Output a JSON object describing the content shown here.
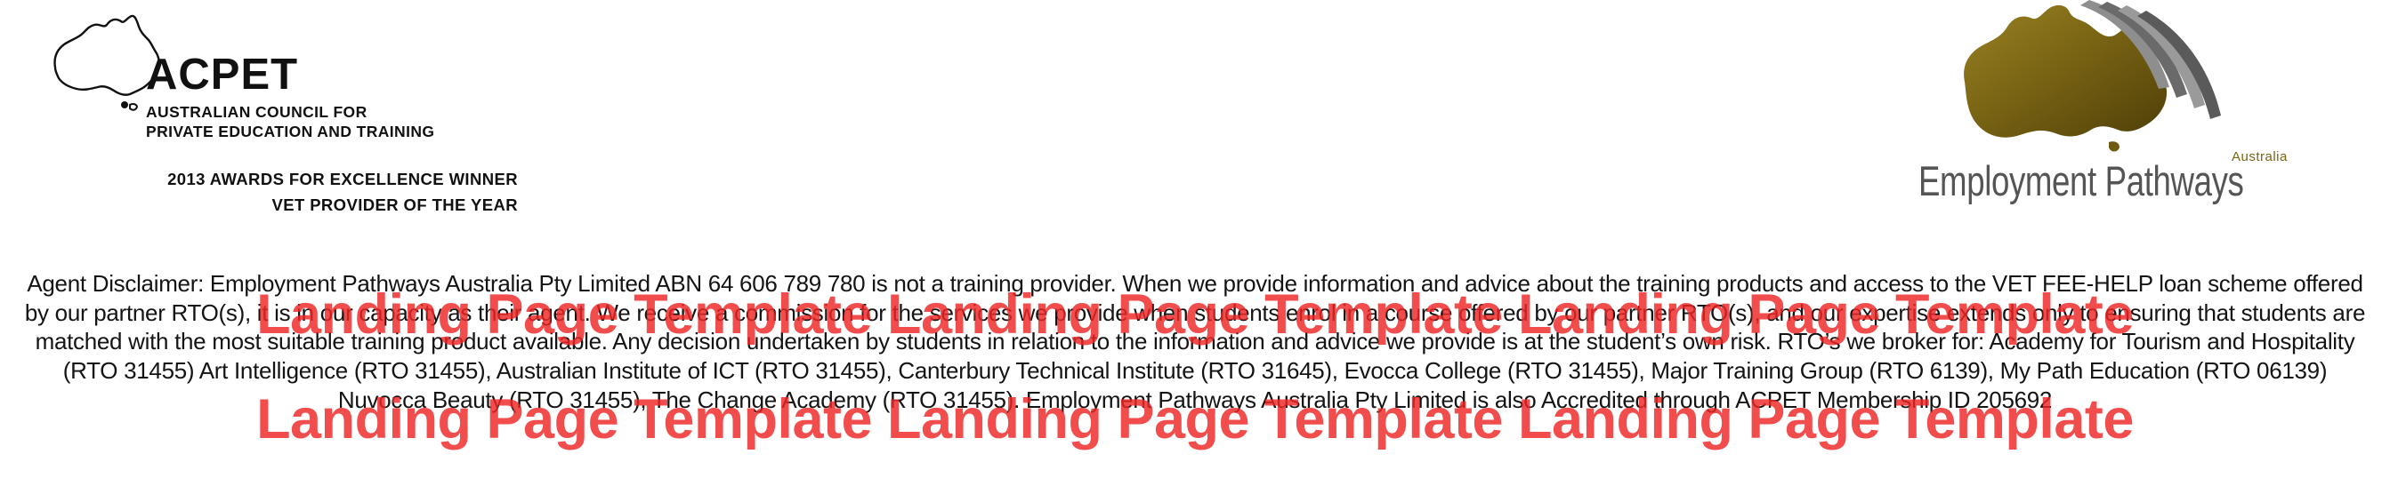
{
  "acpet": {
    "name": "ACPET",
    "subtitle_line1": "AUSTRALIAN COUNCIL FOR",
    "subtitle_line2": "PRIVATE EDUCATION AND TRAINING",
    "award_line1": "2013 AWARDS FOR EXCELLENCE WINNER",
    "award_line2": "VET PROVIDER OF THE YEAR"
  },
  "employment_pathways": {
    "country": "Australia",
    "name": "Employment Pathways",
    "colors": {
      "gold": "#7a6512",
      "gray": "#555555"
    }
  },
  "disclaimer": {
    "text": "Agent Disclaimer: Employment Pathways Australia Pty Limited ABN 64 606 789 780 is not a training provider. When we provide information and advice about the training products and access to the VET FEE-HELP loan scheme offered by our partner RTO(s), it is in our capacity as their agent. We receive a commission for the services we provide when students enrol in a course offered by our partner RTO(s), and our expertise extends only to ensuring that students are matched with the most suitable training product available. Any decision undertaken by students in relation to the information and advice we provide is at the student’s own risk. RTO’s we broker for: Academy for Tourism and Hospitality (RTO 31455) Art Intelligence (RTO 31455), Australian Institute of ICT (RTO 31455), Canterbury Technical Institute (RTO 31645), Evocca College (RTO 31455), Major Training Group (RTO 6139), My Path Education (RTO 06139) Nuvocca Beauty (RTO 31455), The Change Academy (RTO 31455). Employment Pathways Australia Pty Limited is also Accredited through ACPET Membership ID 205692"
  },
  "watermark": {
    "line1": "Landing Page Template Landing Page Template Landing Page Template",
    "line2": "Landing Page Template Landing Page Template Landing Page Template",
    "color": "#ee2626"
  }
}
